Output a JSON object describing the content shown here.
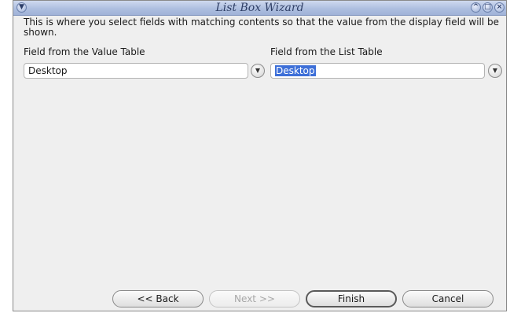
{
  "window": {
    "title": "List Box Wizard"
  },
  "description": "This is where you select fields with matching contents so that the value from the display field will be shown.",
  "value_table": {
    "label": "Field from the Value Table",
    "value": "Desktop"
  },
  "list_table": {
    "label": "Field from the List Table",
    "value": "Desktop"
  },
  "buttons": {
    "back": "<< Back",
    "next": "Next >>",
    "finish": "Finish",
    "cancel": "Cancel"
  },
  "colors": {
    "titlebar": "#aebfe0",
    "selection": "#3d6fd8",
    "panel": "#efefef"
  }
}
